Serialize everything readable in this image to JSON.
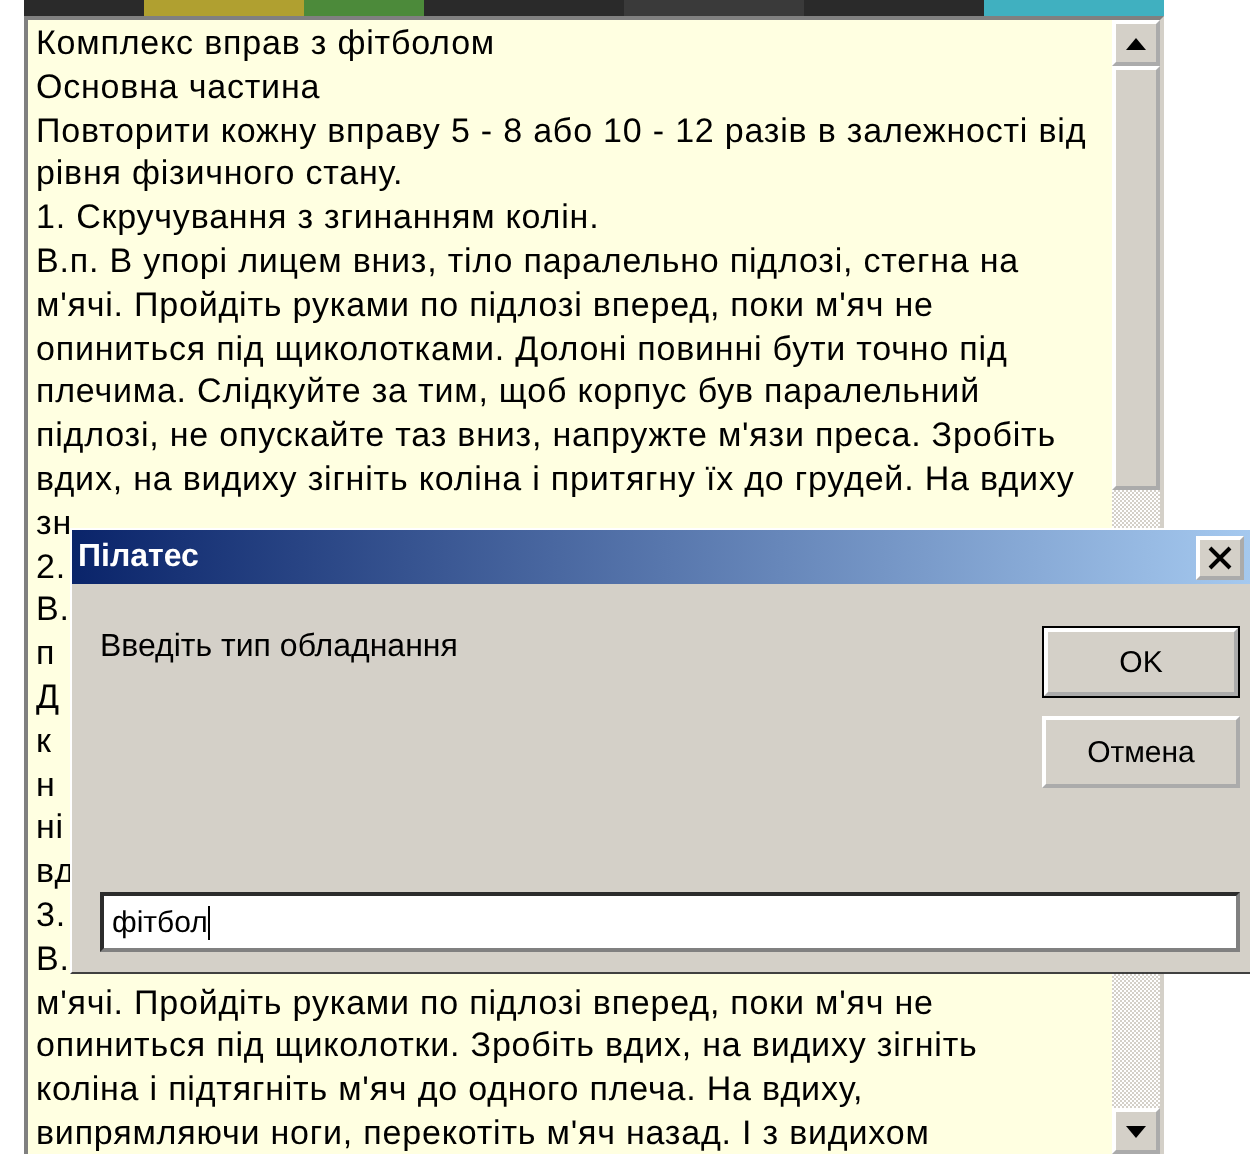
{
  "memo": {
    "lines": [
      "Комплекс вправ з фітболом",
      "Основна частина",
      "Повторити кожну вправу 5 - 8 або 10 - 12 разів в залежності від",
      "рівня фізичного стану.",
      "1. Скручування з згинанням колін.",
      "В.п. В упорі лицем вниз, тіло паралельно підлозі, стегна на",
      "м'ячі. Пройдіть руками по підлозі вперед, поки м'яч не",
      "опиниться під щиколотками. Долоні повинні бути точно під",
      "плечима. Слідкуйте за тим, щоб корпус був паралельний",
      "підлозі, не опускайте таз вниз, напружте м'язи преса. Зробіть",
      "вдих, на видиху зігніть коліна і притягну їх до грудей. На вдиху",
      "зн",
      "2.",
      "В.",
      "п",
      "Д",
      "к",
      "н",
      "ні",
      "вд",
      "3.",
      "В.",
      "м'ячі. Пройдіть руками по підлозі вперед, поки м'яч не",
      "опиниться під щиколотки. Зробіть вдих, на видиху зігніть",
      "коліна і підтягніть м'яч до одного плеча. На вдиху,",
      "випрямляючи ноги, перекотіть м'яч назад. І з видихом"
    ]
  },
  "dialog": {
    "title": "Пілатес",
    "prompt": "Введіть тип обладнання",
    "buttons": [
      {
        "label": "OK",
        "default": true
      },
      {
        "label": "Отмена",
        "default": false
      }
    ],
    "input": {
      "value": "фітбол"
    }
  }
}
